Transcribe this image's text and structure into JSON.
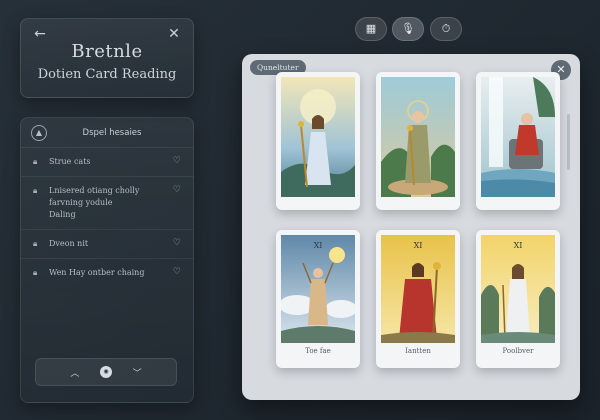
{
  "header": {
    "back_icon": "arrow-left-icon",
    "close_icon": "close-icon",
    "title": "Bretnle",
    "subtitle": "Dotien Card Reading"
  },
  "list": {
    "header_label": "Dspel hesaies",
    "header_icon": "info-icon",
    "items": [
      {
        "label": "Strue cats",
        "icon": "lock-icon"
      },
      {
        "label": "Lnisered otiang cholly\nfarvning yodule\nDaling",
        "icon": "lock-icon"
      },
      {
        "label": "Dveon nit",
        "icon": "lock-icon"
      },
      {
        "label": "Wen Hay ontber chaing",
        "icon": "lock-icon"
      }
    ],
    "footer": {
      "up_icon": "chevron-up-icon",
      "mid_icon": "eye-icon",
      "down_icon": "chevron-down-icon"
    }
  },
  "toolbar": {
    "buttons": [
      "grid-icon",
      "mic-icon",
      "timer-icon"
    ],
    "active": "mic-icon"
  },
  "gallery": {
    "tag": "Quneltuter",
    "cards": [
      {
        "caption": "",
        "numeral": "",
        "scene": "woman-staff-sun"
      },
      {
        "caption": "",
        "numeral": "",
        "scene": "woman-staff-halo"
      },
      {
        "caption": "",
        "numeral": "",
        "scene": "woman-red-waterfall"
      },
      {
        "caption": "Toe fae",
        "numeral": "XI",
        "scene": "figure-raising-staff"
      },
      {
        "caption": "Iantten",
        "numeral": "XI",
        "scene": "man-red-robe"
      },
      {
        "caption": "Poolbver",
        "numeral": "XI",
        "scene": "woman-white-golden"
      }
    ]
  },
  "colors": {
    "background": "#222b33",
    "panel": "#d7dbe0",
    "accent": "#5e6a74"
  }
}
